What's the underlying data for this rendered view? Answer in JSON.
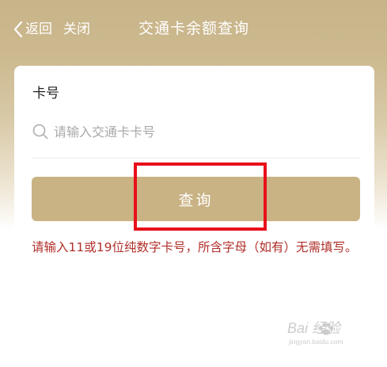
{
  "nav": {
    "back_label": "返回",
    "close_label": "关闭",
    "title": "交通卡余额查询"
  },
  "form": {
    "card_label": "卡号",
    "card_input_placeholder": "请输入交通卡卡号",
    "card_input_value": "",
    "query_button_label": "查询",
    "hint_text": "请输入11或19位纯数字卡号，所含字母（如有）无需填写。"
  },
  "watermark": {
    "brand": "Bai 经验",
    "url": "jingyan.baidu.com"
  },
  "colors": {
    "header_gold": "#c8b489",
    "button_gold": "#c9b283",
    "hint_red": "#b0302b",
    "highlight_red": "#e8101a"
  },
  "icons": {
    "back": "chevron-left-icon",
    "search": "search-icon",
    "watermark": "baidu-paw-icon"
  }
}
